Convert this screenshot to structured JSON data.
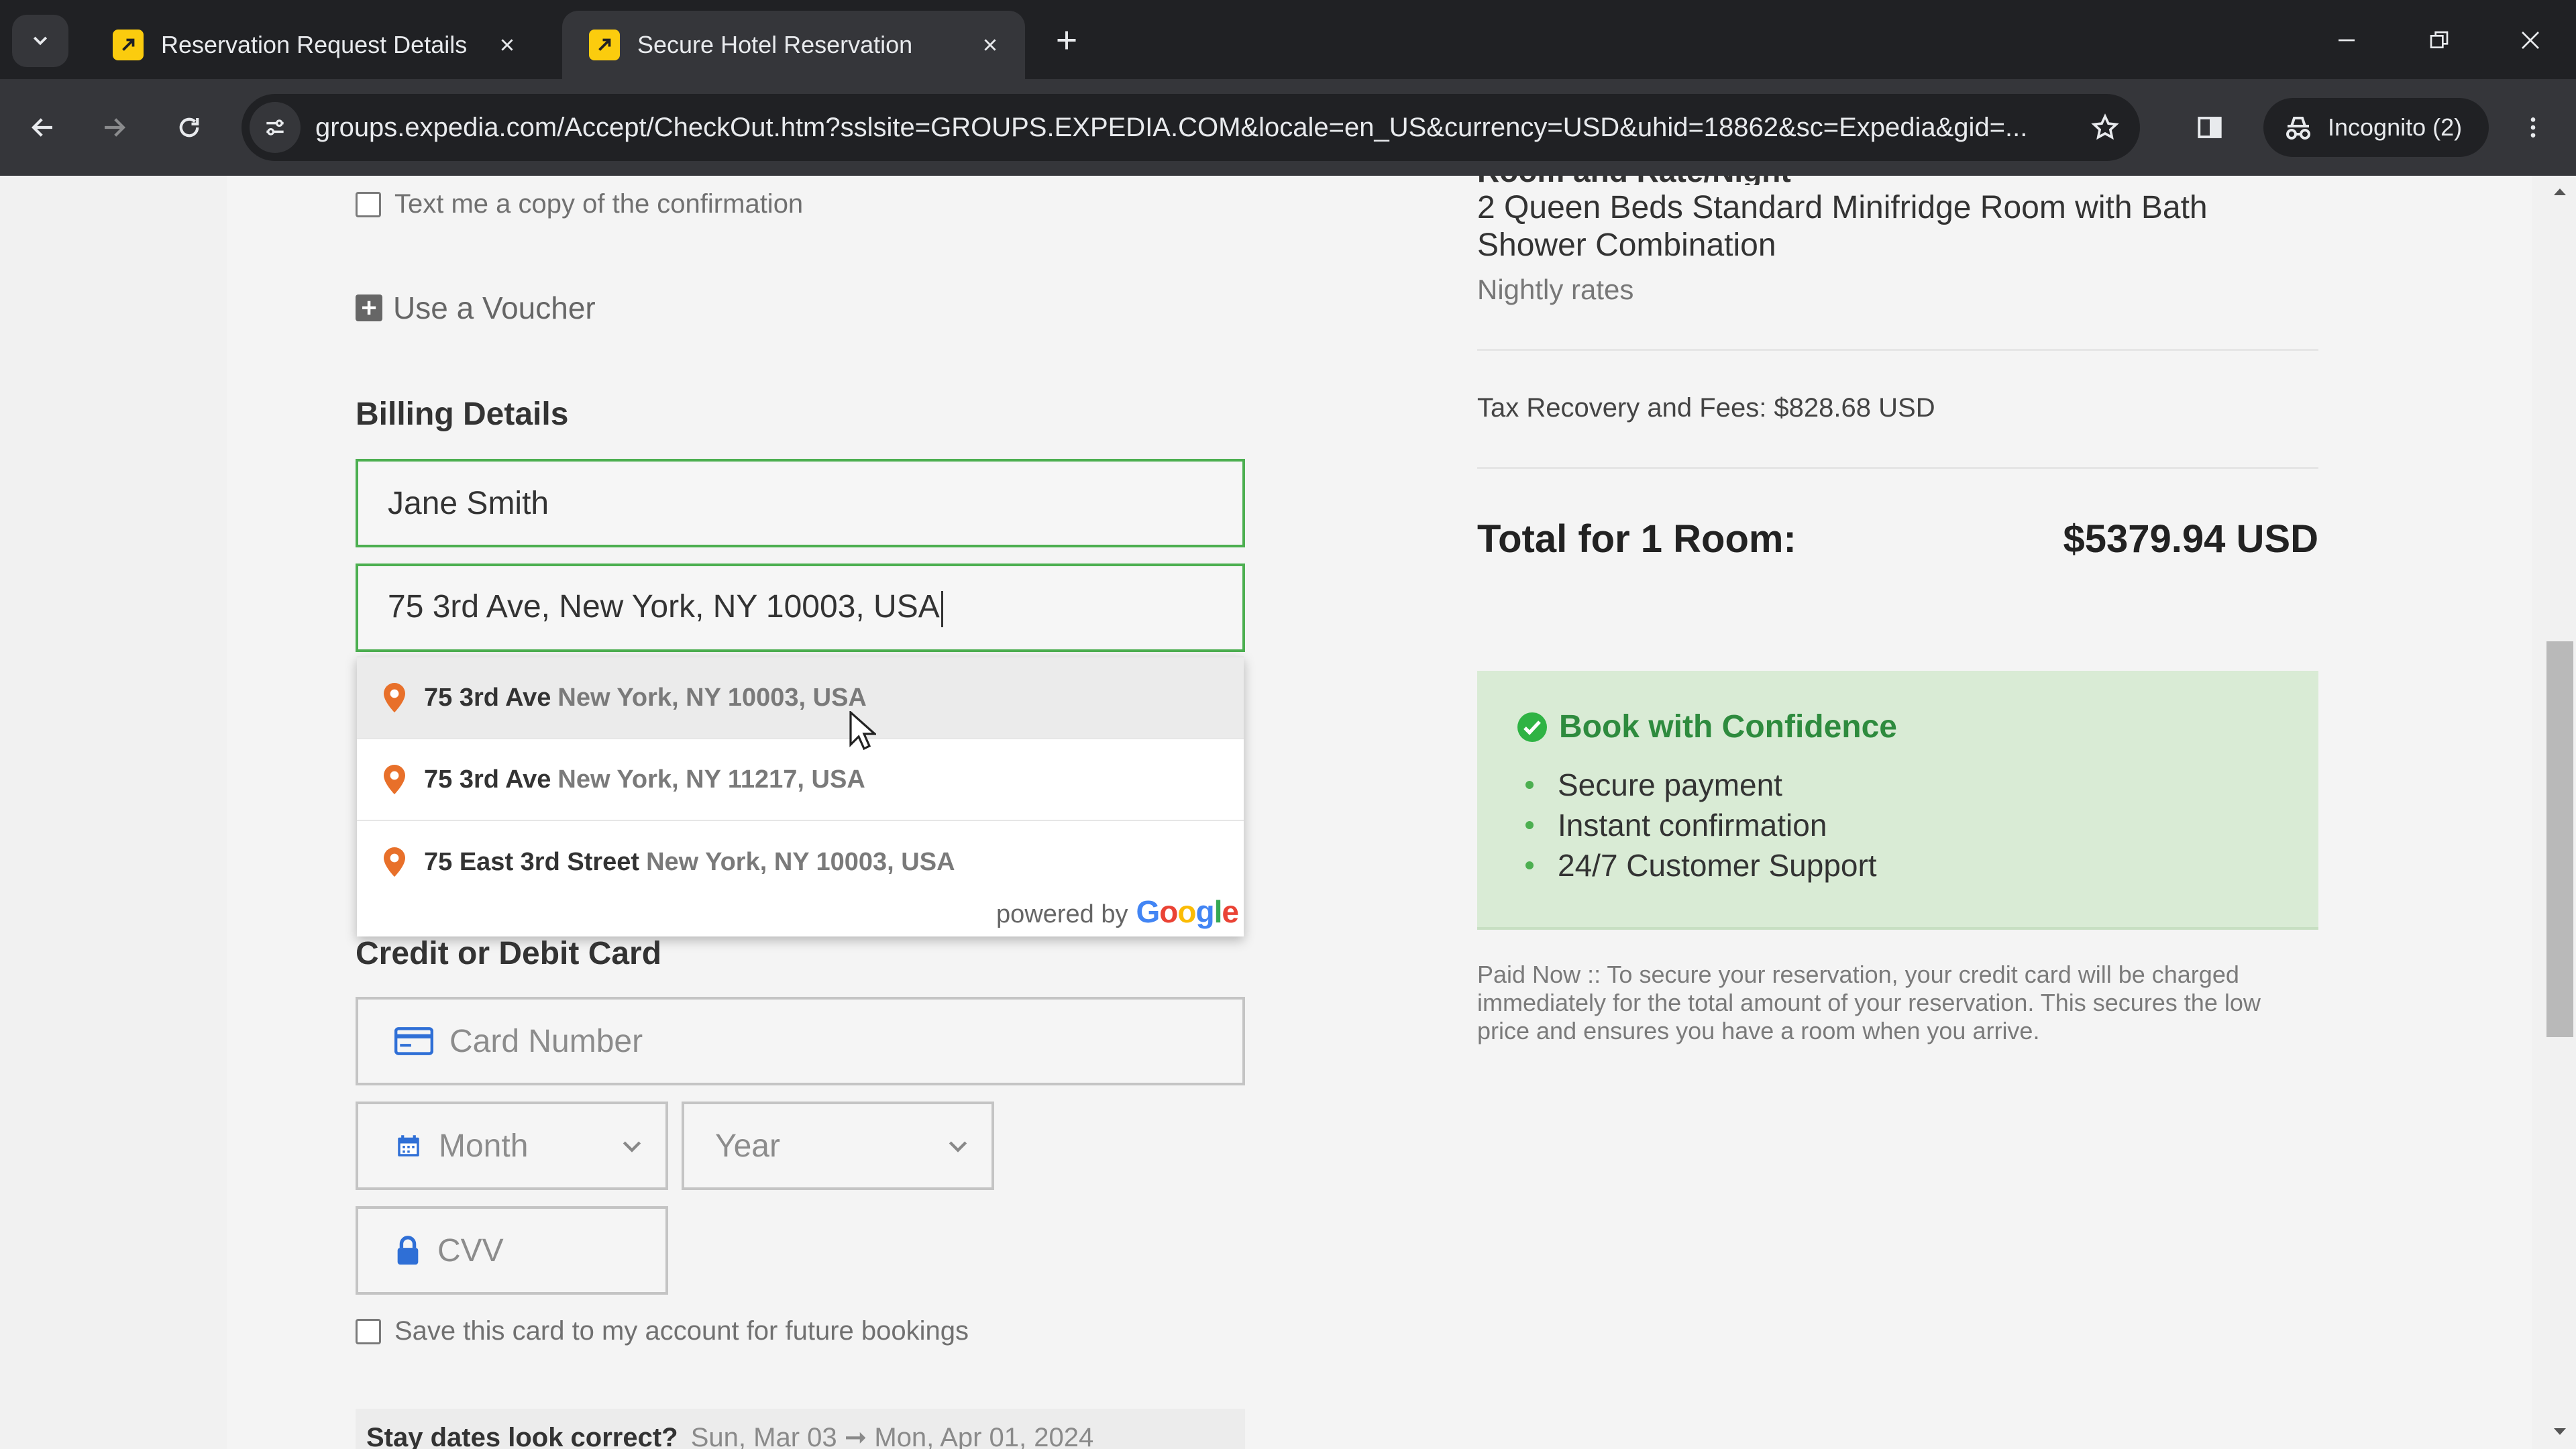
{
  "browser": {
    "tabs": [
      {
        "title": "Reservation Request Details",
        "active": false
      },
      {
        "title": "Secure Hotel Reservation",
        "active": true
      }
    ],
    "url": "groups.expedia.com/Accept/CheckOut.htm?sslsite=GROUPS.EXPEDIA.COM&locale=en_US&currency=USD&uhid=18862&sc=Expedia&gid=...",
    "profile_label": "Incognito (2)"
  },
  "form": {
    "text_copy_label": "Text me a copy of the confirmation",
    "voucher_label": "Use a Voucher",
    "billing_heading": "Billing Details",
    "name_value": "Jane Smith",
    "address_value": "75 3rd Ave, New York, NY 10003, USA",
    "suggestions": [
      {
        "main": "75 3rd Ave",
        "secondary": "New York, NY 10003, USA"
      },
      {
        "main": "75 3rd Ave",
        "secondary": "New York, NY 11217, USA"
      },
      {
        "main": "75 East 3rd Street",
        "secondary": "New York, NY 10003, USA"
      }
    ],
    "powered_by": "powered by",
    "google_letters": [
      "G",
      "o",
      "o",
      "g",
      "l",
      "e"
    ],
    "card_heading": "Credit or Debit Card",
    "card_placeholder": "Card Number",
    "month_placeholder": "Month",
    "year_placeholder": "Year",
    "cvv_placeholder": "CVV",
    "save_card_label": "Save this card to my account for future bookings",
    "stay_dates_question": "Stay dates look correct?",
    "stay_dates_value": "Sun, Mar 03 ➞ Mon, Apr 01, 2024"
  },
  "summary": {
    "room_heading_cut": "Room and Rate/Night",
    "room_description": "2 Queen Beds Standard Minifridge Room with Bath Shower Combination",
    "nightly_rates_label": "Nightly rates",
    "tax_line": "Tax Recovery and Fees: $828.68 USD",
    "total_label": "Total for 1 Room:",
    "total_value": "$5379.94 USD",
    "confidence_title": "Book with Confidence",
    "confidence_items": [
      "Secure payment",
      "Instant confirmation",
      "24/7 Customer Support"
    ],
    "paid_now_text": "Paid Now :: To secure your reservation, your credit card will be charged immediately for the total amount of your reservation. This secures the low price and ensures you have a room when you arrive."
  },
  "colors": {
    "valid_border": "#4caf50",
    "confidence_bg": "#d9ebd5",
    "confidence_green": "#2e8b3e",
    "pin_orange": "#e8702a",
    "google_colors": [
      "#4285f4",
      "#ea4335",
      "#fbbc05",
      "#4285f4",
      "#34a853",
      "#ea4335"
    ]
  }
}
